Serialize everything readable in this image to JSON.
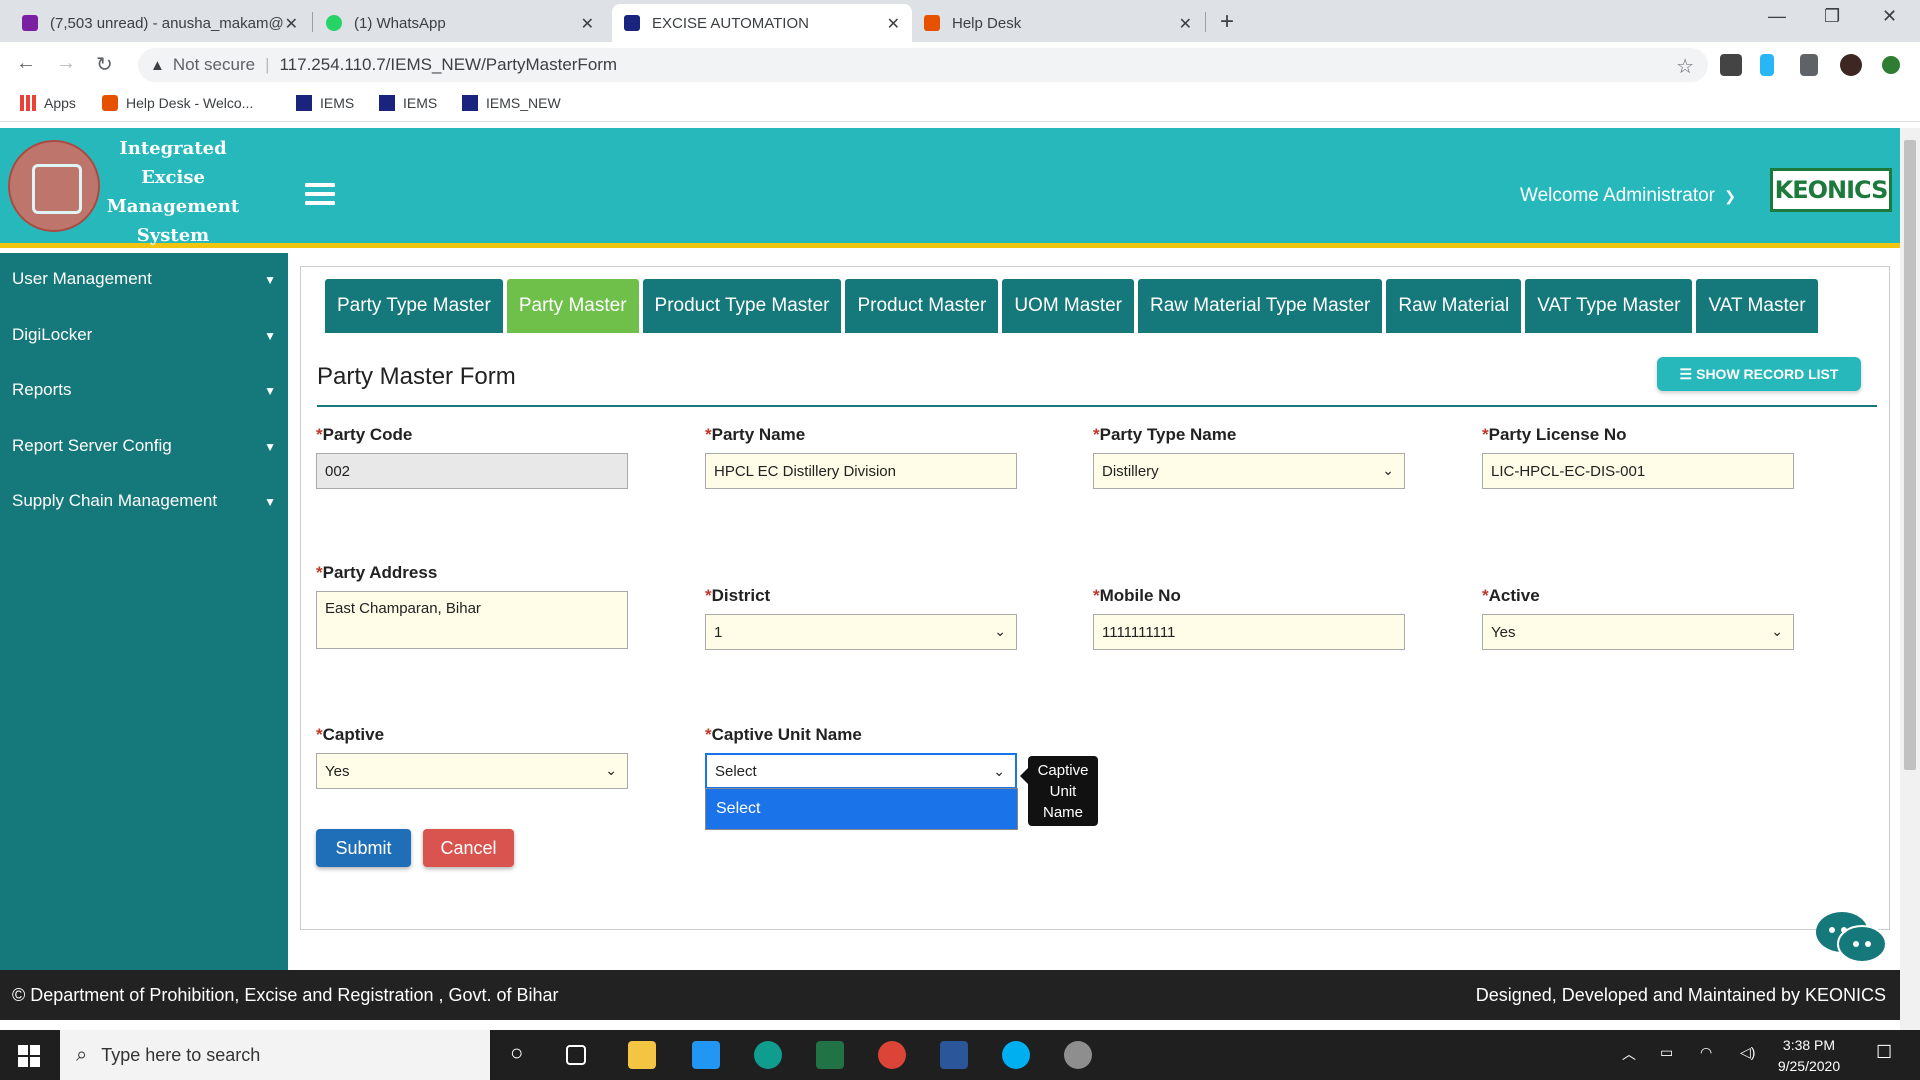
{
  "browser": {
    "tabs": [
      {
        "title": "(7,503 unread) - anusha_makam@",
        "icon_color": "#7b1fa2"
      },
      {
        "title": "(1) WhatsApp",
        "icon_color": "#25d366"
      },
      {
        "title": "EXCISE AUTOMATION",
        "icon_color": "#1a237e"
      },
      {
        "title": "Help Desk",
        "icon_color": "#e65100"
      }
    ],
    "active_tab": 2,
    "security_label": "Not secure",
    "url": "117.254.110.7/IEMS_NEW/PartyMasterForm",
    "bookmarks": [
      "Apps",
      "Help Desk - Welco...",
      "IEMS",
      "IEMS",
      "IEMS_NEW"
    ]
  },
  "header": {
    "app_title": "Integrated Excise Management System",
    "welcome": "Welcome Administrator",
    "brand": "KEONICS"
  },
  "sidebar": {
    "items": [
      {
        "label": "User Management"
      },
      {
        "label": "DigiLocker"
      },
      {
        "label": "Reports"
      },
      {
        "label": "Report Server Config"
      },
      {
        "label": "Supply Chain Management"
      }
    ]
  },
  "tabs": [
    "Party Type Master",
    "Party Master",
    "Product Type Master",
    "Product Master",
    "UOM Master",
    "Raw Material Type Master",
    "Raw Material",
    "VAT Type Master",
    "VAT Master"
  ],
  "active_master_tab": 1,
  "form": {
    "title": "Party Master Form",
    "show_record_list": "SHOW RECORD LIST",
    "party_code": {
      "label": "Party Code",
      "value": "002"
    },
    "party_name": {
      "label": "Party Name",
      "value": "HPCL EC Distillery Division"
    },
    "party_type_name": {
      "label": "Party Type Name",
      "value": "Distillery"
    },
    "party_license_no": {
      "label": "Party License No",
      "value": "LIC-HPCL-EC-DIS-001"
    },
    "party_address": {
      "label": "Party Address",
      "value": "East Champaran, Bihar"
    },
    "district": {
      "label": "District",
      "value": "1"
    },
    "mobile_no": {
      "label": "Mobile No",
      "value": "1111111111"
    },
    "active": {
      "label": "Active",
      "value": "Yes"
    },
    "captive": {
      "label": "Captive",
      "value": "Yes"
    },
    "captive_unit_name": {
      "label": "Captive Unit Name",
      "value": "Select",
      "options": [
        "Select"
      ]
    },
    "tooltip": "Captive Unit Name",
    "submit": "Submit",
    "cancel": "Cancel"
  },
  "footer": {
    "left": "© Department of Prohibition, Excise and Registration , Govt. of Bihar",
    "right": "Designed, Developed and Maintained by KEONICS"
  },
  "taskbar": {
    "search_placeholder": "Type here to search",
    "time": "3:38 PM",
    "date": "9/25/2020"
  },
  "colors": {
    "header": "#27b8bc",
    "sidebar": "#15787a",
    "active_tab": "#6ec04b",
    "submit": "#1e6fb8",
    "cancel": "#d9534f"
  }
}
